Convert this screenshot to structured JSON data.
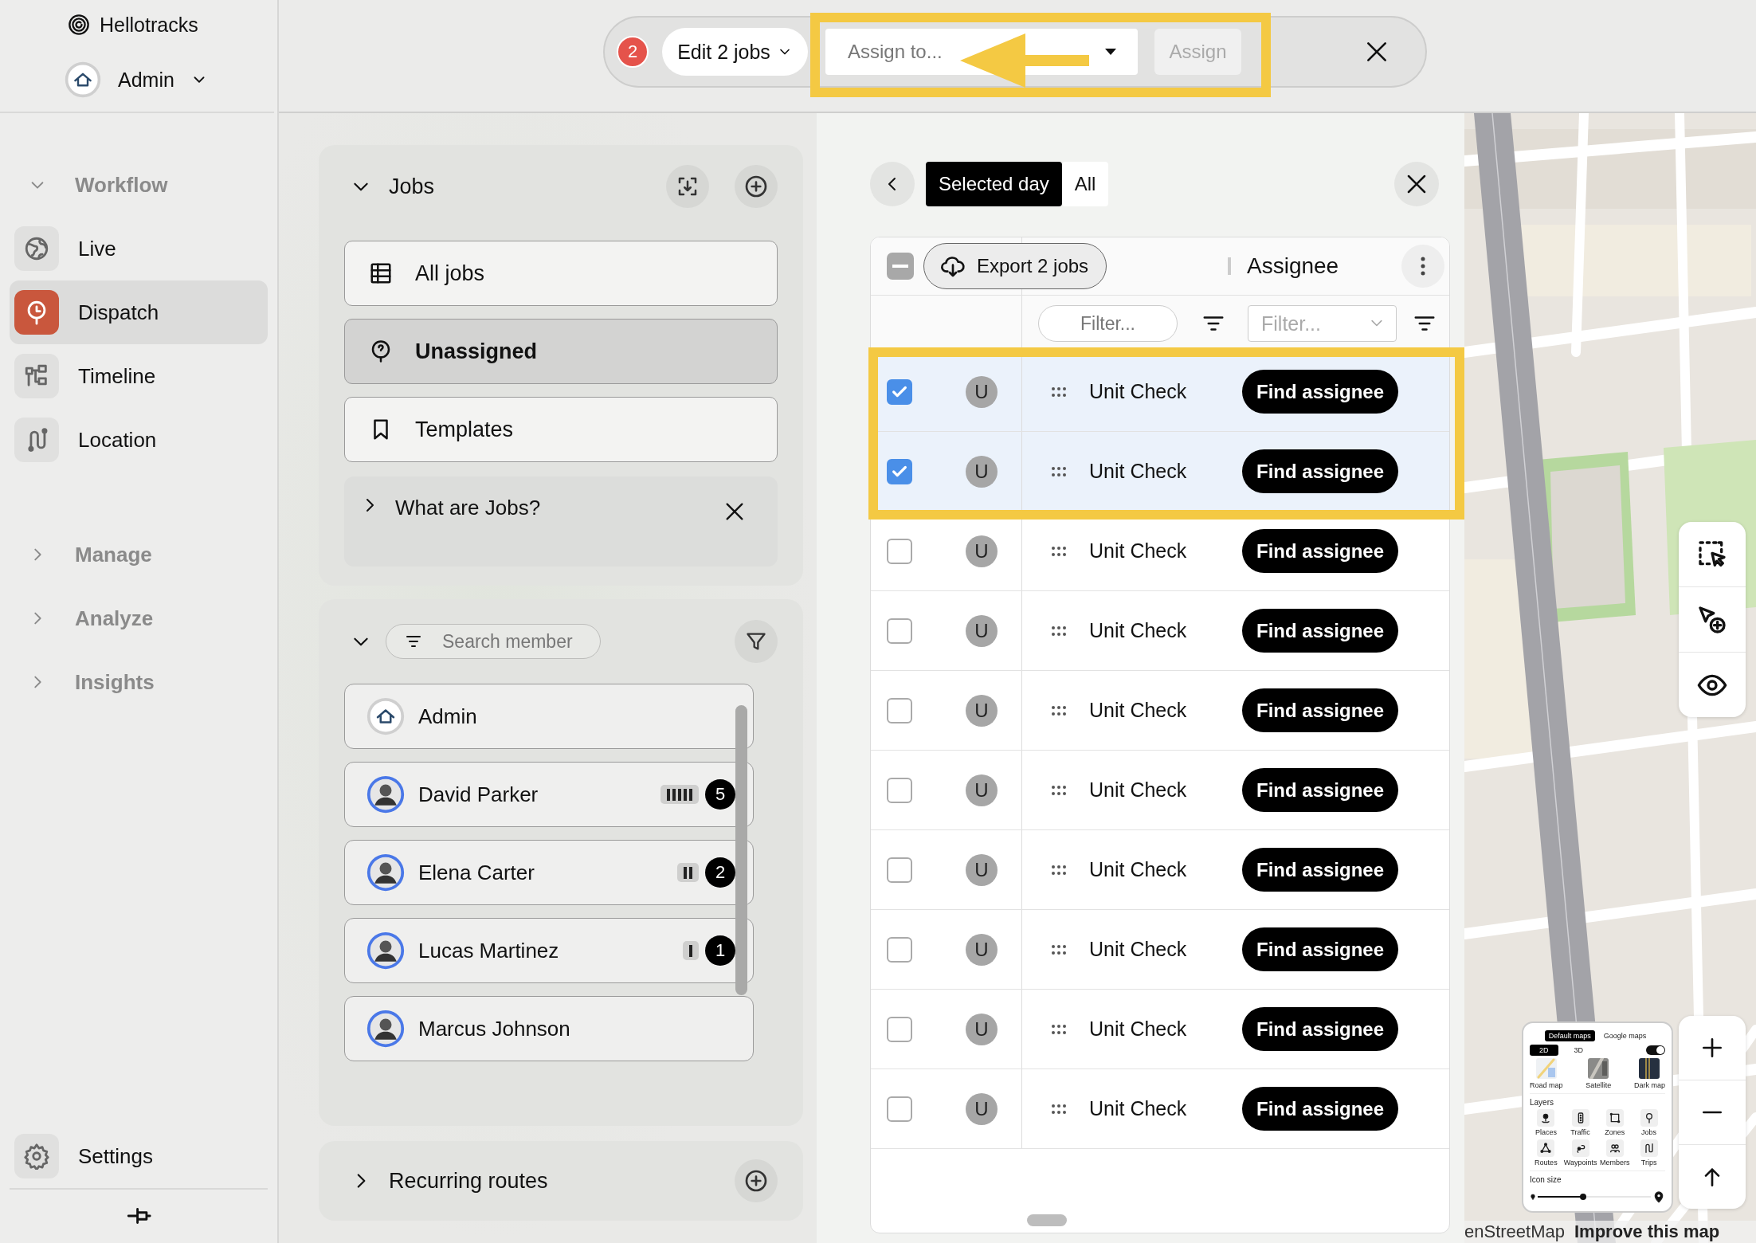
{
  "sidebar": {
    "brand": "Hellotracks",
    "account": {
      "name": "Admin"
    },
    "sections": [
      {
        "label": "Workflow",
        "expanded": true,
        "items": [
          {
            "label": "Live",
            "selected": false
          },
          {
            "label": "Dispatch",
            "selected": true
          },
          {
            "label": "Timeline",
            "selected": false
          },
          {
            "label": "Location",
            "selected": false
          }
        ]
      },
      {
        "label": "Manage",
        "expanded": false
      },
      {
        "label": "Analyze",
        "expanded": false
      },
      {
        "label": "Insights",
        "expanded": false
      }
    ],
    "settings": "Settings"
  },
  "action_bar": {
    "count": "2",
    "edit_menu": "Edit 2 jobs",
    "assign_field": {
      "placeholder": "Assign to..."
    },
    "assign_button": {
      "label": "Assign",
      "disabled": true
    }
  },
  "jobs_panel": {
    "title": "Jobs",
    "expanded": true,
    "items": [
      {
        "label": "All jobs",
        "selected": false
      },
      {
        "label": "Unassigned",
        "selected": true
      },
      {
        "label": "Templates",
        "selected": false
      }
    ],
    "help": {
      "label": "What are Jobs?",
      "expanded": false
    }
  },
  "members_panel": {
    "expanded": true,
    "search": {
      "placeholder": "Search member"
    },
    "members": [
      {
        "name": "Admin",
        "kind": "company"
      },
      {
        "name": "David Parker",
        "kind": "person",
        "count": "5"
      },
      {
        "name": "Elena Carter",
        "kind": "person",
        "count": "2"
      },
      {
        "name": "Lucas Martinez",
        "kind": "person",
        "count": "1"
      },
      {
        "name": "Marcus Johnson",
        "kind": "person"
      }
    ]
  },
  "recurring_routes": {
    "title": "Recurring routes",
    "expanded": false
  },
  "jobs_table": {
    "mode_tabs": [
      {
        "label": "Selected day",
        "selected": true
      },
      {
        "label": "All",
        "selected": false
      }
    ],
    "select_all": {
      "indeterminate": true
    },
    "export_button": "Export 2 jobs",
    "columns": [
      {
        "label": "Assignee"
      }
    ],
    "filters": [
      {
        "placeholder": "Filter..."
      },
      {
        "placeholder": "Filter..."
      }
    ],
    "rows": [
      {
        "checked": true,
        "avatar": "U",
        "title": "Unit Check",
        "action": "Find assignee"
      },
      {
        "checked": true,
        "avatar": "U",
        "title": "Unit Check",
        "action": "Find assignee"
      },
      {
        "checked": false,
        "avatar": "U",
        "title": "Unit Check",
        "action": "Find assignee"
      },
      {
        "checked": false,
        "avatar": "U",
        "title": "Unit Check",
        "action": "Find assignee"
      },
      {
        "checked": false,
        "avatar": "U",
        "title": "Unit Check",
        "action": "Find assignee"
      },
      {
        "checked": false,
        "avatar": "U",
        "title": "Unit Check",
        "action": "Find assignee"
      },
      {
        "checked": false,
        "avatar": "U",
        "title": "Unit Check",
        "action": "Find assignee"
      },
      {
        "checked": false,
        "avatar": "U",
        "title": "Unit Check",
        "action": "Find assignee"
      },
      {
        "checked": false,
        "avatar": "U",
        "title": "Unit Check",
        "action": "Find assignee"
      },
      {
        "checked": false,
        "avatar": "U",
        "title": "Unit Check",
        "action": "Find assignee"
      }
    ]
  },
  "map": {
    "legend": {
      "sources": [
        {
          "label": "Default maps",
          "selected": true
        },
        {
          "label": "Google maps",
          "selected": false
        }
      ],
      "view_modes": [
        {
          "label": "2D",
          "selected": true
        },
        {
          "label": "3D",
          "selected": false
        }
      ],
      "toggle": {
        "on": true
      },
      "styles": [
        {
          "label": "Road map"
        },
        {
          "label": "Satellite"
        },
        {
          "label": "Dark map"
        }
      ],
      "layers_title": "Layers",
      "layers": [
        {
          "label": "Places"
        },
        {
          "label": "Traffic"
        },
        {
          "label": "Zones"
        },
        {
          "label": "Jobs"
        },
        {
          "label": "Routes"
        },
        {
          "label": "Waypoints"
        },
        {
          "label": "Members"
        },
        {
          "label": "Trips"
        }
      ],
      "icon_size_title": "Icon size",
      "icon_size": {
        "level": 0.4
      }
    },
    "attribution": {
      "source": "enStreetMap",
      "link": "Improve this map"
    }
  }
}
